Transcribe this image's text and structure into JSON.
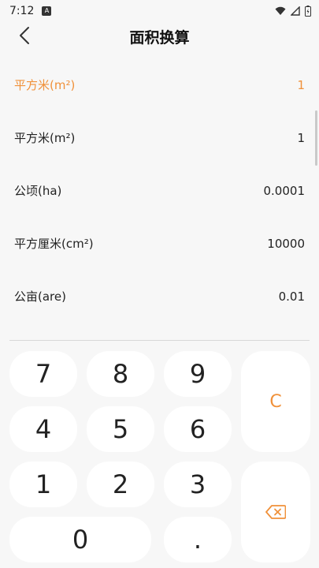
{
  "status": {
    "time": "7:12"
  },
  "header": {
    "title": "面积换算"
  },
  "units": [
    {
      "label": "平方米(m²)",
      "value": "1",
      "active": true
    },
    {
      "label": "平方米(m²)",
      "value": "1"
    },
    {
      "label": "公顷(ha)",
      "value": "0.0001"
    },
    {
      "label": "平方厘米(cm²)",
      "value": "10000"
    },
    {
      "label": "公亩(are)",
      "value": "0.01"
    }
  ],
  "keypad": {
    "k7": "7",
    "k8": "8",
    "k9": "9",
    "k4": "4",
    "k5": "5",
    "k6": "6",
    "k1": "1",
    "k2": "2",
    "k3": "3",
    "k0": "0",
    "dot": ".",
    "clear": "C"
  },
  "colors": {
    "accent": "#f0913a",
    "background": "#f7f7f7",
    "key": "#ffffff"
  },
  "icons": {
    "back": "chevron-left-icon",
    "backspace": "backspace-icon"
  }
}
